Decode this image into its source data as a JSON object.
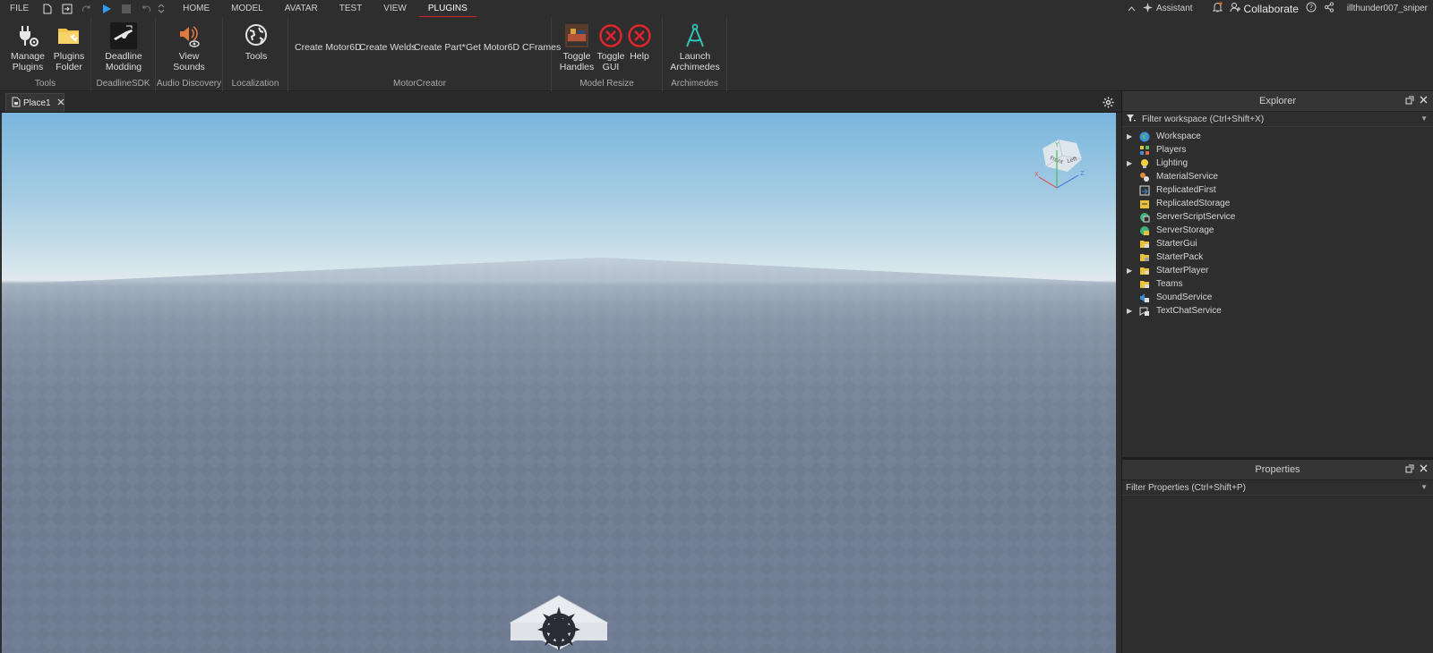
{
  "menubar": {
    "file_label": "FILE",
    "tabs": [
      {
        "label": "HOME"
      },
      {
        "label": "MODEL"
      },
      {
        "label": "AVATAR"
      },
      {
        "label": "TEST"
      },
      {
        "label": "VIEW"
      },
      {
        "label": "PLUGINS",
        "active": true
      }
    ],
    "assistant_label": "Assistant",
    "collaborate_label": "Collaborate",
    "username": "illthunder007_sniper"
  },
  "ribbon": {
    "groups": [
      {
        "label": "Tools",
        "buttons": [
          {
            "label": "Manage\nPlugins",
            "icon": "plug-gear-icon"
          },
          {
            "label": "Plugins\nFolder",
            "icon": "folder-plug-icon"
          }
        ]
      },
      {
        "label": "DeadlineSDK",
        "buttons": [
          {
            "label": "Deadline\nModding",
            "icon": "rifle-icon"
          }
        ]
      },
      {
        "label": "Audio Discovery",
        "buttons": [
          {
            "label": "View\nSounds",
            "icon": "speaker-eye-icon"
          }
        ]
      },
      {
        "label": "Localization",
        "buttons": [
          {
            "label": "Tools",
            "icon": "globe-tools-icon"
          }
        ]
      },
      {
        "label": "MotorCreator",
        "buttons": [
          {
            "label": "Create Motor6D"
          },
          {
            "label": "Create Welds"
          },
          {
            "label": "Create Part*"
          },
          {
            "label": "Get Motor6D CFrames"
          }
        ]
      },
      {
        "label": "Model Resize",
        "buttons": [
          {
            "label": "Toggle\nHandles",
            "icon": "handles-thumbnail-icon"
          },
          {
            "label": "Toggle\nGUI",
            "icon": "red-x-icon"
          },
          {
            "label": "Help",
            "icon": "red-x-icon"
          }
        ]
      },
      {
        "label": "Archimedes",
        "buttons": [
          {
            "label": "Launch\nArchimedes",
            "icon": "compass-icon"
          }
        ]
      }
    ]
  },
  "document": {
    "tab_label": "Place1"
  },
  "explorer": {
    "title": "Explorer",
    "filter_placeholder": "Filter workspace (Ctrl+Shift+X)",
    "items": [
      {
        "label": "Workspace",
        "expandable": true,
        "icon": "globe-icon"
      },
      {
        "label": "Players",
        "expandable": false,
        "icon": "players-icon"
      },
      {
        "label": "Lighting",
        "expandable": true,
        "icon": "lightbulb-icon"
      },
      {
        "label": "MaterialService",
        "expandable": false,
        "icon": "material-icon"
      },
      {
        "label": "ReplicatedFirst",
        "expandable": false,
        "icon": "replicated-first-icon"
      },
      {
        "label": "ReplicatedStorage",
        "expandable": false,
        "icon": "replicated-storage-icon"
      },
      {
        "label": "ServerScriptService",
        "expandable": false,
        "icon": "server-script-icon"
      },
      {
        "label": "ServerStorage",
        "expandable": false,
        "icon": "server-storage-icon"
      },
      {
        "label": "StarterGui",
        "expandable": false,
        "icon": "folder-gui-icon"
      },
      {
        "label": "StarterPack",
        "expandable": false,
        "icon": "folder-pack-icon"
      },
      {
        "label": "StarterPlayer",
        "expandable": true,
        "icon": "folder-player-icon"
      },
      {
        "label": "Teams",
        "expandable": false,
        "icon": "teams-icon"
      },
      {
        "label": "SoundService",
        "expandable": false,
        "icon": "sound-icon"
      },
      {
        "label": "TextChatService",
        "expandable": true,
        "icon": "chat-icon"
      }
    ]
  },
  "properties": {
    "title": "Properties",
    "filter_placeholder": "Filter Properties (Ctrl+Shift+P)"
  },
  "view_cube": {
    "face_labels": [
      "Front",
      "Left"
    ],
    "axis_labels": [
      "X",
      "Y",
      "Z"
    ]
  }
}
